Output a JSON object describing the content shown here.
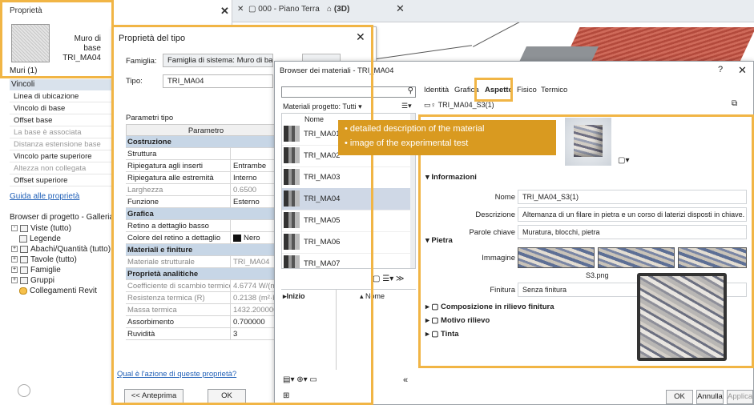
{
  "props": {
    "title": "Proprietà",
    "type_name_line1": "Muro di base",
    "type_name_line2": "TRI_MA04",
    "selection": "Muri (1)",
    "section": "Vincoli",
    "rows": [
      {
        "label": "Linea di ubicazione",
        "grey": false
      },
      {
        "label": "Vincolo di base",
        "grey": false
      },
      {
        "label": "Offset base",
        "grey": false
      },
      {
        "label": "La base è associata",
        "grey": true
      },
      {
        "label": "Distanza estensione base",
        "grey": true
      },
      {
        "label": "Vincolo parte superiore",
        "grey": false
      },
      {
        "label": "Altezza non collegata",
        "grey": true
      },
      {
        "label": "Offset superiore",
        "grey": false
      }
    ],
    "help_link": "Guida alle proprietà",
    "browser_title": "Browser di progetto - Galleria",
    "tree": [
      {
        "sign": "-",
        "label": "Viste (tutto)",
        "indent": 0
      },
      {
        "sign": "",
        "label": "Legende",
        "indent": 1
      },
      {
        "sign": "+",
        "label": "Abachi/Quantità (tutto)",
        "indent": 0
      },
      {
        "sign": "+",
        "label": "Tavole (tutto)",
        "indent": 0
      },
      {
        "sign": "+",
        "label": "Famiglie",
        "indent": 0
      },
      {
        "sign": "+",
        "label": "Gruppi",
        "indent": 0
      },
      {
        "sign": "",
        "label": "Collegamenti Revit",
        "indent": 1
      }
    ]
  },
  "view_tabs": {
    "tab1": "000 - Piano Terra",
    "tab2": "(3D)"
  },
  "type_dialog": {
    "title": "Proprietà del tipo",
    "famiglia_label": "Famiglia:",
    "famiglia_value": "Famiglia di sistema: Muro di base",
    "tipo_label": "Tipo:",
    "tipo_value": "TRI_MA04",
    "params_label": "Parametri tipo",
    "header": "Parametro",
    "rows": [
      {
        "c1": "Costruzione",
        "c2": "",
        "kind": "sec"
      },
      {
        "c1": "Struttura",
        "c2": "",
        "kind": "row"
      },
      {
        "c1": "Ripiegatura agli inserti",
        "c2": "Entrambe",
        "kind": "row"
      },
      {
        "c1": "Ripiegatura alle estremità",
        "c2": "Interno",
        "kind": "row"
      },
      {
        "c1": "Larghezza",
        "c2": "0.6500",
        "kind": "grey"
      },
      {
        "c1": "Funzione",
        "c2": "Esterno",
        "kind": "row"
      },
      {
        "c1": "Grafica",
        "c2": "",
        "kind": "sec"
      },
      {
        "c1": "Retino a dettaglio basso",
        "c2": "",
        "kind": "row"
      },
      {
        "c1": "Colore del retino a dettaglio",
        "c2": "Nero",
        "kind": "color"
      },
      {
        "c1": "Materiali e finiture",
        "c2": "",
        "kind": "sec"
      },
      {
        "c1": "Materiale strutturale",
        "c2": "TRI_MA04",
        "kind": "grey"
      },
      {
        "c1": "Proprietà analitiche",
        "c2": "",
        "kind": "sec"
      },
      {
        "c1": "Coefficiente di scambio termico",
        "c2": "4.6774 W/(m²",
        "kind": "grey"
      },
      {
        "c1": "Resistenza termica (R)",
        "c2": "0.2138 (m²·K",
        "kind": "grey"
      },
      {
        "c1": "Massa termica",
        "c2": "1432.200000",
        "kind": "grey"
      },
      {
        "c1": "Assorbimento",
        "c2": "0.700000",
        "kind": "row"
      },
      {
        "c1": "Ruvidità",
        "c2": "3",
        "kind": "row"
      }
    ],
    "question_link": "Qual è l'azione di queste proprietà?",
    "preview_btn": "<< Anteprima",
    "ok_btn": "OK"
  },
  "mat_browser": {
    "title": "Browser dei materiali - TRI_MA04",
    "help": "?",
    "filter_label": "Materiali progetto: Tutti",
    "col_nome": "Nome",
    "items": [
      "TRI_MA01",
      "TRI_MA02",
      "TRI_MA03",
      "TRI_MA04",
      "TRI_MA05",
      "TRI_MA06",
      "TRI_MA07"
    ],
    "selected_index": 3,
    "lower_left": "Inizio",
    "lower_right": "Nome",
    "tabs": [
      "Identità",
      "Grafica",
      "Aspetto",
      "Fisico",
      "Termico"
    ],
    "active_tab": "Aspetto",
    "asset_name": "TRI_MA04_S3(1)",
    "info_section": "Informazioni",
    "info": [
      {
        "label": "Nome",
        "value": "TRI_MA04_S3(1)"
      },
      {
        "label": "Descrizione",
        "value": "Altemanza di un filare in pietra e un corso di laterizi disposti in chiave."
      },
      {
        "label": "Parole chiave",
        "value": "Muratura, blocchi, pietra"
      }
    ],
    "stone_section": "Pietra",
    "image_label": "Immagine",
    "image_file": "S3.png",
    "finish_label": "Finitura",
    "finish_value": "Senza finitura",
    "sub_sections": [
      "Composizione in rilievo finitura",
      "Motivo rilievo",
      "Tinta"
    ],
    "ok_btn": "OK",
    "cancel_btn": "Annulla",
    "apply_btn": "Applica"
  },
  "annotation": {
    "line1": "• detailed description of the material",
    "line2": "• image of the experimental test"
  }
}
